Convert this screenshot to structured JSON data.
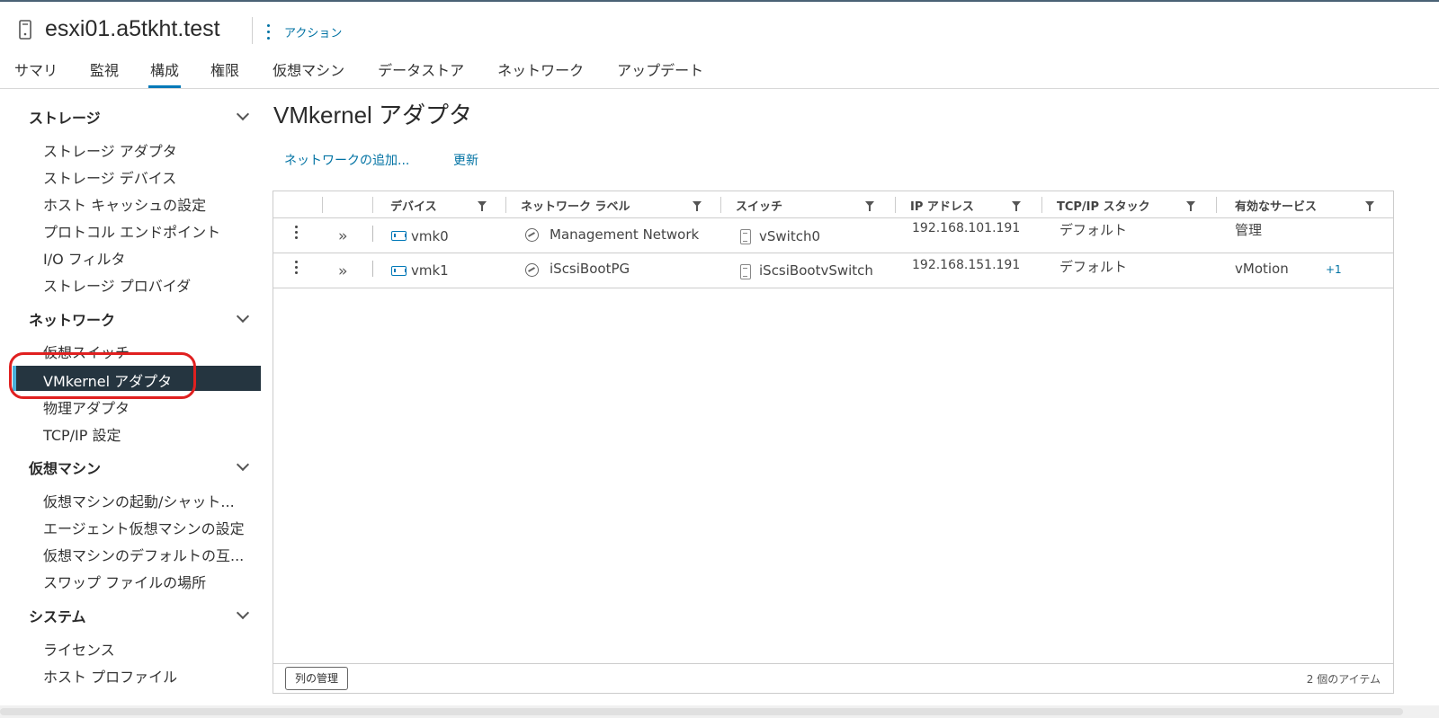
{
  "header": {
    "host_name": "esxi01.a5tkht.test",
    "action_label": "アクション",
    "tabs": [
      "サマリ",
      "監視",
      "構成",
      "権限",
      "仮想マシン",
      "データストア",
      "ネットワーク",
      "アップデート"
    ],
    "active_tab": "構成"
  },
  "sidebar": {
    "groups": [
      {
        "label": "ストレージ",
        "items": [
          "ストレージ アダプタ",
          "ストレージ デバイス",
          "ホスト キャッシュの設定",
          "プロトコル エンドポイント",
          "I/O フィルタ",
          "ストレージ プロバイダ"
        ]
      },
      {
        "label": "ネットワーク",
        "items": [
          "仮想スイッチ",
          "VMkernel アダプタ",
          "物理アダプタ",
          "TCP/IP 設定"
        ]
      },
      {
        "label": "仮想マシン",
        "items": [
          "仮想マシンの起動/シャット...",
          "エージェント仮想マシンの設定",
          "仮想マシンのデフォルトの互...",
          "スワップ ファイルの場所"
        ]
      },
      {
        "label": "システム",
        "items": [
          "ライセンス",
          "ホスト プロファイル"
        ]
      }
    ],
    "active_item": "VMkernel アダプタ"
  },
  "main": {
    "title": "VMkernel アダプタ",
    "toolbar": {
      "add_network": "ネットワークの追加...",
      "refresh": "更新"
    },
    "columns": [
      "デバイス",
      "ネットワーク ラベル",
      "スイッチ",
      "IP アドレス",
      "TCP/IP スタック",
      "有効なサービス"
    ],
    "rows": [
      {
        "device": "vmk0",
        "network_label": "Management Network",
        "switch": "vSwitch0",
        "ip": "192.168.101.191",
        "stack": "デフォルト",
        "services": "管理",
        "extra": ""
      },
      {
        "device": "vmk1",
        "network_label": "iScsiBootPG",
        "switch": "iScsiBootvSwitch",
        "ip": "192.168.151.191",
        "stack": "デフォルト",
        "services": "vMotion",
        "extra": "+1"
      }
    ],
    "footer": {
      "manage_columns": "列の管理",
      "item_count": "2 個のアイテム"
    }
  }
}
